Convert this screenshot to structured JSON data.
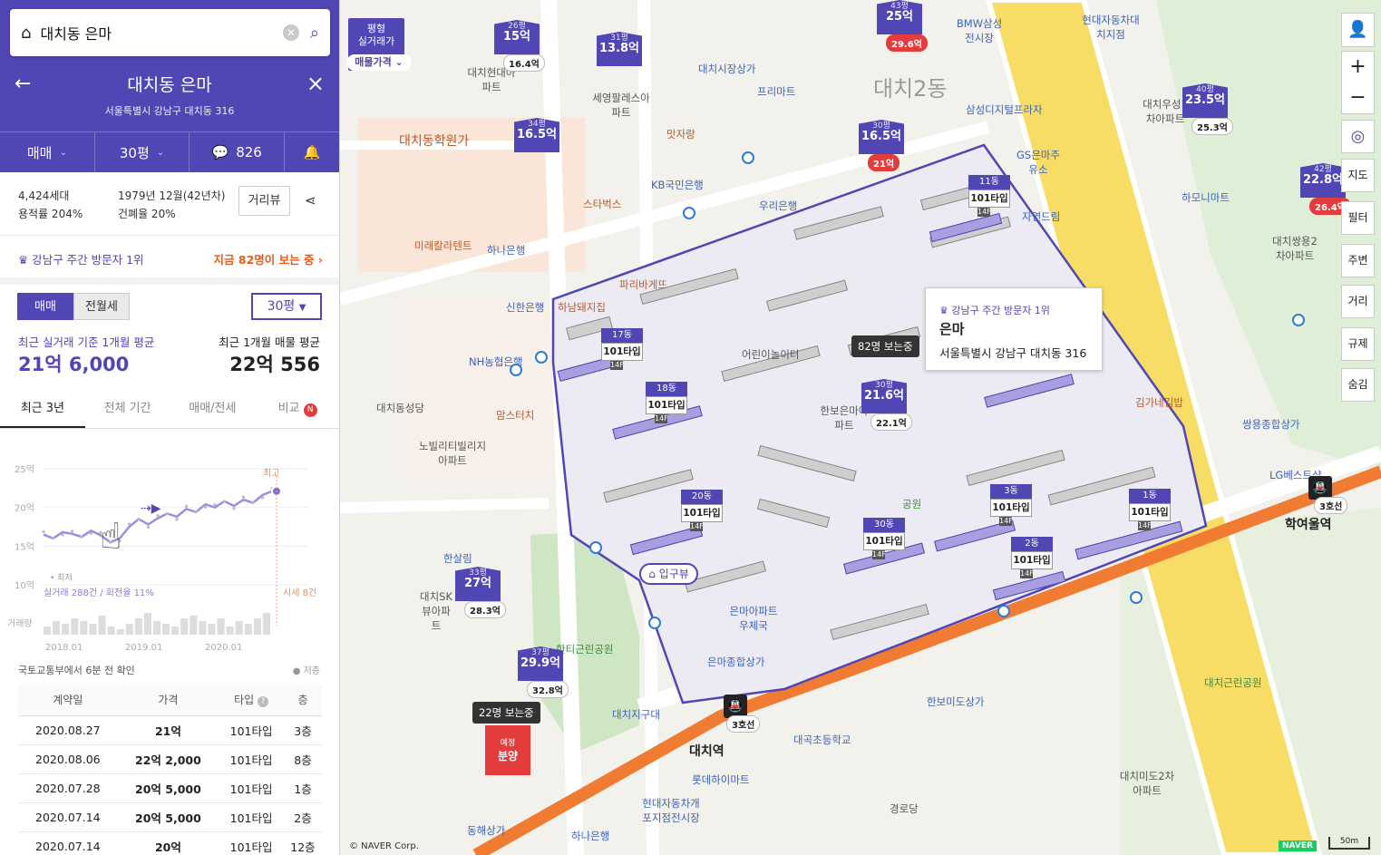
{
  "search": {
    "query": "대치동 은마"
  },
  "header": {
    "title": "대치동 은마",
    "address": "서울특별시 강남구 대치동 316"
  },
  "toolbar": {
    "deal_type": "매매",
    "size": "30평",
    "comment_count": "826"
  },
  "summary": {
    "households": "4,424세대",
    "far": "용적률 204%",
    "built": "1979년 12월(42년차)",
    "bcr": "건폐율 20%",
    "street_view": "거리뷰"
  },
  "ranking": {
    "label": "강남구 주간 방문자 1위",
    "live": "지금 82명이 보는 중"
  },
  "trade": {
    "seg": [
      "매매",
      "전월세"
    ],
    "size_select": "30평",
    "recent_label": "최근 실거래 기준 1개월 평균",
    "recent_value": "21억 6,000",
    "listing_label": "최근 1개월 매물 평균",
    "listing_value": "22억 556"
  },
  "tabs": [
    "최근 3년",
    "전체 기간",
    "매매/전세",
    "비교"
  ],
  "tab_badge": "N",
  "chart_data": {
    "type": "line",
    "y_ticks": [
      "25억",
      "20억",
      "15억",
      "10억"
    ],
    "x_ticks": [
      "2018.01",
      "2019.01",
      "2020.01"
    ],
    "volume_label": "거래량",
    "legend_low": "최저",
    "max_label": "최고",
    "deals_label": "실거래 288건 / 회전율 11%",
    "market_label": "시세 8건",
    "ylim": [
      10,
      25
    ],
    "series": [
      {
        "values": [
          16.5,
          16.0,
          16.8,
          16.6,
          16.2,
          17.0,
          16.4,
          15.5,
          16.0,
          17.5,
          18.5,
          17.8,
          18.6,
          19.2,
          18.8,
          19.8,
          19.4,
          20.4,
          20.0,
          20.8,
          20.2,
          21.0,
          20.6,
          21.6,
          22.1
        ]
      }
    ],
    "volume": [
      3,
      5,
      4,
      6,
      5,
      4,
      7,
      3,
      2,
      4,
      6,
      8,
      5,
      4,
      3,
      6,
      7,
      5,
      4,
      6,
      3,
      5,
      4,
      6,
      8
    ]
  },
  "deals": {
    "source": "국토교통부에서 6분 전 확인",
    "low_floor": "저층",
    "headers": [
      "계약일",
      "가격",
      "타입",
      "층"
    ],
    "rows": [
      [
        "2020.08.27",
        "21억",
        "101타입",
        "3층"
      ],
      [
        "2020.08.06",
        "22억 2,000",
        "101타입",
        "8층"
      ],
      [
        "2020.07.28",
        "20억 5,000",
        "101타입",
        "1층"
      ],
      [
        "2020.07.14",
        "20억 5,000",
        "101타입",
        "2층"
      ],
      [
        "2020.07.14",
        "20억",
        "101타입",
        "12층"
      ]
    ]
  },
  "map": {
    "top_filter_title": "평형\n실거래가",
    "price_filter": "매물가격",
    "area_labels": [
      "대치2동",
      "대치동학원가"
    ],
    "popup": {
      "rank": "강남구 주간 방문자 1위",
      "name": "은마",
      "address": "서울특별시 강남구 대치동 316"
    },
    "viewers_main": "82명 보는중",
    "viewers_other": "22명 보는중",
    "entrance": "입구뷰",
    "presale": "분양",
    "presale_small": "예정",
    "naver": "NAVER",
    "copyright": "© NAVER Corp.",
    "scale": "50m",
    "right_buttons": [
      "지도",
      "필터",
      "주변",
      "거리",
      "규제",
      "숨김"
    ],
    "price_pins": [
      {
        "size": "26평",
        "price": "15억",
        "sub": "16.4억"
      },
      {
        "size": "31평",
        "price": "13.8억",
        "sub": ""
      },
      {
        "size": "43평",
        "price": "25억",
        "sub": "29.6억"
      },
      {
        "size": "34평",
        "price": "16.5억",
        "sub": ""
      },
      {
        "size": "30평",
        "price": "16.5억",
        "sub": "21억"
      },
      {
        "size": "40평",
        "price": "23.5억",
        "sub": "25.3억"
      },
      {
        "size": "42평",
        "price": "22.8억",
        "sub": "26.4억"
      },
      {
        "size": "30평",
        "price": "21.6억",
        "sub": "22.1억"
      },
      {
        "size": "33평",
        "price": "27억",
        "sub": "28.3억"
      },
      {
        "size": "37평",
        "price": "29.9억",
        "sub": "32.8억"
      }
    ],
    "dongs": [
      {
        "name": "11동",
        "type": "101타입",
        "floor": "14F"
      },
      {
        "name": "17동",
        "type": "101타입",
        "floor": "14F"
      },
      {
        "name": "18동",
        "type": "101타입",
        "floor": "14F"
      },
      {
        "name": "20동",
        "type": "101타입",
        "floor": "14F"
      },
      {
        "name": "30동",
        "type": "101타입",
        "floor": "14F"
      },
      {
        "name": "3동",
        "type": "101타입",
        "floor": "14F"
      },
      {
        "name": "2동",
        "type": "101타입",
        "floor": "14F"
      },
      {
        "name": "1동",
        "type": "101타입",
        "floor": "14F"
      }
    ],
    "places": [
      "대치현대아파트",
      "세영팔레스아파트",
      "대치시장상가",
      "프리마트",
      "맛자랑",
      "삼성디지털프라자",
      "GS은마주유소",
      "KB국민은행",
      "스타벅스",
      "우리은행",
      "자연드림",
      "하나은행",
      "미래칼라텐트",
      "파리바게뜨",
      "신한은행",
      "하남돼지집",
      "NH농협은행",
      "대치동성당",
      "노빌리티빌리지아파트",
      "맘스터치",
      "어린이놀이터",
      "공원",
      "한보은마아파트",
      "김가네김밥",
      "은마아파트우체국",
      "은마종합상가",
      "한티근린공원",
      "대치역",
      "롯데하이마트",
      "대곡초등학교",
      "한보미도상가",
      "학여울역",
      "대치근린공원",
      "대치미도2차아파트",
      "하모니마트",
      "대치쌍용2차아파트",
      "대치우성1차아파트",
      "쌍용종합상가",
      "LG베스트샵",
      "현대자동차대치지점",
      "BMW삼성전시장",
      "하나은행",
      "동해상가",
      "경로당",
      "한살림",
      "대치SK뷰아파트",
      "대치지구대",
      "현대자동차개포지점전시장"
    ],
    "line_label": "3호선"
  }
}
